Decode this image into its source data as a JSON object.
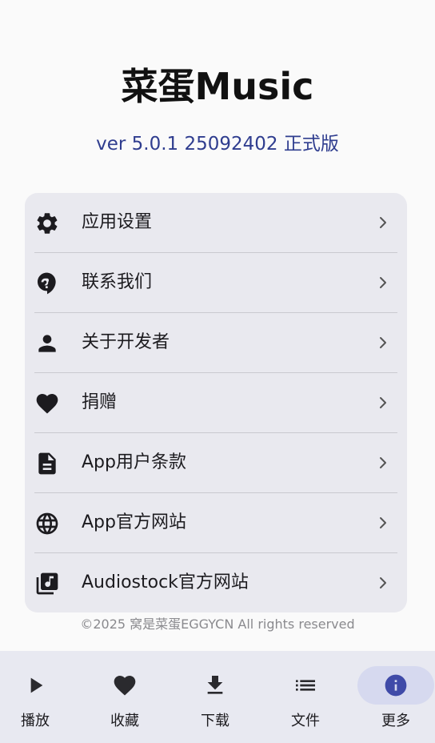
{
  "header": {
    "title": "菜蛋Music",
    "version": "ver 5.0.1 25092402 正式版"
  },
  "menu": {
    "items": [
      {
        "label": "应用设置",
        "icon": "settings-gear-icon"
      },
      {
        "label": "联系我们",
        "icon": "help-chat-icon"
      },
      {
        "label": "关于开发者",
        "icon": "person-icon"
      },
      {
        "label": "捐赠",
        "icon": "heart-icon"
      },
      {
        "label": "App用户条款",
        "icon": "document-icon"
      },
      {
        "label": "App官方网站",
        "icon": "globe-icon"
      },
      {
        "label": "Audiostock官方网站",
        "icon": "music-library-icon"
      }
    ]
  },
  "footer": {
    "copyright": "©2025 窝是菜蛋EGGYCN All rights reserved"
  },
  "bottom_nav": {
    "items": [
      {
        "label": "播放",
        "icon": "play-icon"
      },
      {
        "label": "收藏",
        "icon": "heart-icon"
      },
      {
        "label": "下载",
        "icon": "download-icon"
      },
      {
        "label": "文件",
        "icon": "list-icon"
      },
      {
        "label": "更多",
        "icon": "info-icon",
        "active": true
      }
    ]
  },
  "colors": {
    "accent": "#2f3d8f",
    "active_indicator": "#d6d9ef",
    "active_icon": "#3f4aa8",
    "card_background": "#e9e9ef",
    "nav_background": "#e8e9f1"
  }
}
